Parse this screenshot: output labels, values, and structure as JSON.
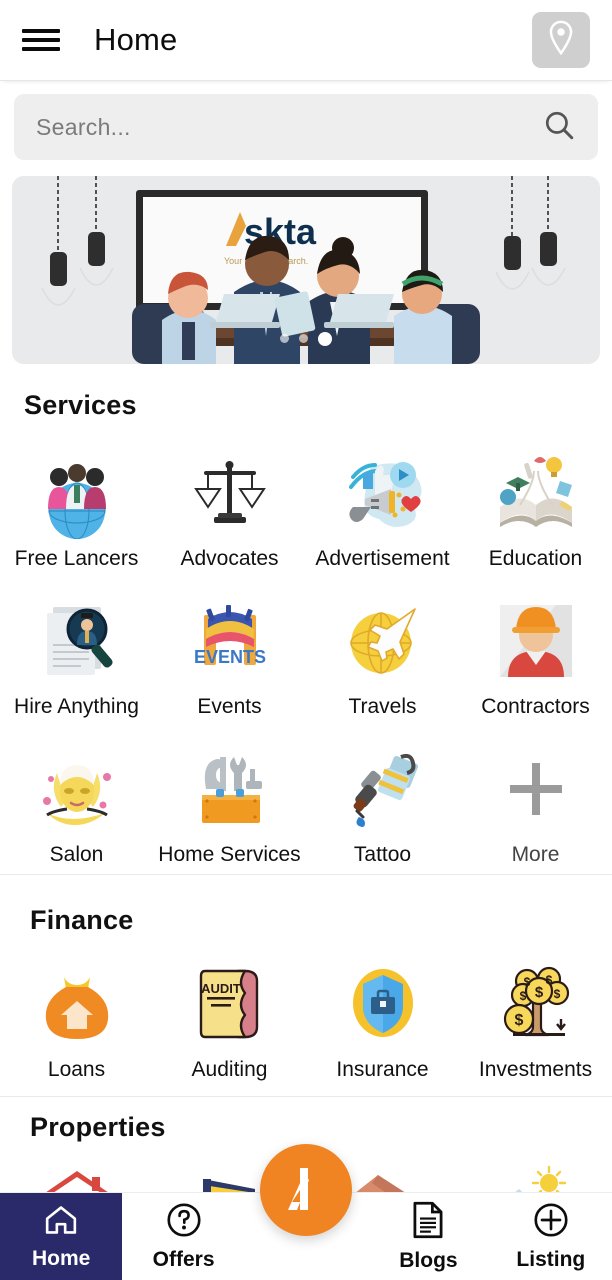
{
  "header": {
    "title": "Home",
    "menu_icon": "hamburger-menu-icon",
    "location_icon": "location-pin-icon"
  },
  "search": {
    "placeholder": "Search...",
    "value": "",
    "icon": "search-icon"
  },
  "hero": {
    "alt": "Business team meeting illustration",
    "brand_text": "Askta",
    "tagline": "Your Service Search.",
    "dots": 3,
    "active_dot": 3
  },
  "sections": [
    {
      "title": "Services",
      "items": [
        {
          "label": "Free Lancers",
          "icon": "freelancers-icon"
        },
        {
          "label": "Advocates",
          "icon": "scales-of-justice-icon"
        },
        {
          "label": "Advertisement",
          "icon": "megaphone-icon"
        },
        {
          "label": "Education",
          "icon": "open-book-icon"
        },
        {
          "label": "Hire Anything",
          "icon": "documents-magnifier-icon"
        },
        {
          "label": "Events",
          "icon": "events-banner-icon"
        },
        {
          "label": "Travels",
          "icon": "globe-airplane-icon"
        },
        {
          "label": "Contractors",
          "icon": "construction-worker-icon"
        },
        {
          "label": "Salon",
          "icon": "facial-spa-icon"
        },
        {
          "label": "Home Services",
          "icon": "toolbox-icon"
        },
        {
          "label": "Tattoo",
          "icon": "tattoo-machine-icon"
        },
        {
          "label": "More",
          "icon": "plus-icon"
        }
      ]
    },
    {
      "title": "Finance",
      "items": [
        {
          "label": "Loans",
          "icon": "money-bag-house-icon"
        },
        {
          "label": "Auditing",
          "icon": "audit-folder-icon"
        },
        {
          "label": "Insurance",
          "icon": "shield-briefcase-icon"
        },
        {
          "label": "Investments",
          "icon": "money-tree-icon"
        }
      ]
    },
    {
      "title": "Properties",
      "items": [
        {
          "label": "",
          "icon": "red-roof-house-icon"
        },
        {
          "label": "",
          "icon": "yellow-land-plot-icon"
        },
        {
          "label": "",
          "icon": "terracotta-roof-icon"
        },
        {
          "label": "",
          "icon": "sunny-plot-icon"
        }
      ]
    }
  ],
  "bottom_nav": {
    "items": [
      {
        "label": "Home",
        "icon": "home-icon",
        "active": true
      },
      {
        "label": "Offers",
        "icon": "question-circle-icon",
        "active": false
      },
      {
        "label": "Blogs",
        "icon": "document-icon",
        "active": false
      },
      {
        "label": "Listing",
        "icon": "plus-circle-icon",
        "active": false
      }
    ],
    "fab": {
      "icon": "askta-logo-icon",
      "label": "A"
    }
  },
  "colors": {
    "accent_orange": "#f08322",
    "nav_active_navy": "#2a2a6b",
    "search_bg": "#eeeeee",
    "location_btn_bg": "#cfcfcf",
    "divider": "#e9e9e9"
  }
}
